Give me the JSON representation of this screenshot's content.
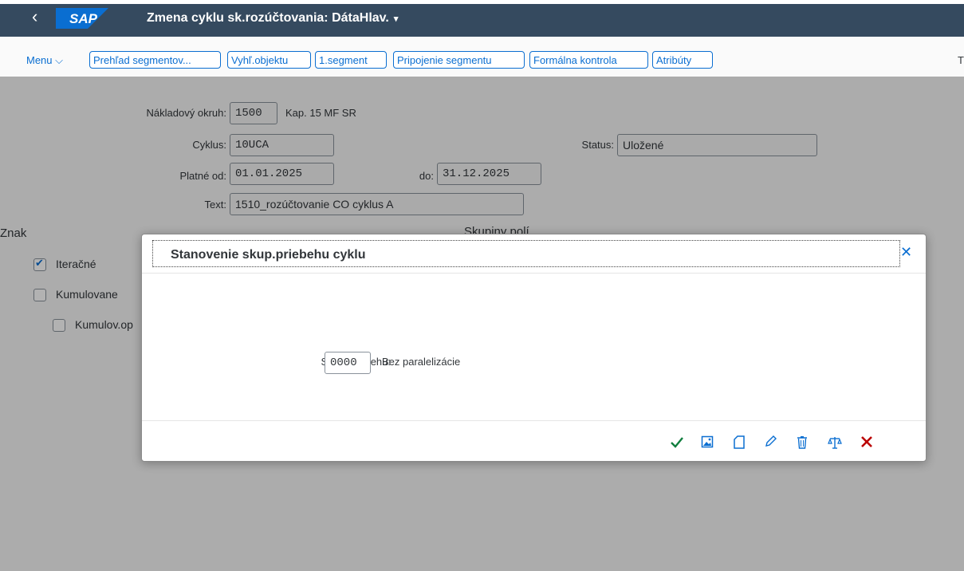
{
  "header": {
    "back_icon": "‹",
    "logo_text": "SAP",
    "title": "Zmena cyklu sk.rozúčtovania: DátaHlav.",
    "title_caret": "▾"
  },
  "toolbar": {
    "menu_label": "Menu ⌵",
    "buttons": [
      "Prehľad segmentov...",
      "Vyhľ.objektu",
      "1.segment",
      "Pripojenie segmentu",
      "Formálna kontrola",
      "Atribúty"
    ],
    "overflow_label": "T"
  },
  "form": {
    "cost_area_label": "Nákladový okruh:",
    "cost_area_value": "1500",
    "cost_area_desc": "Kap. 15 MF SR",
    "cycle_label": "Cyklus:",
    "cycle_value": "10UCA",
    "status_label": "Status:",
    "status_value": "Uložené",
    "valid_from_label": "Platné od:",
    "valid_from_value": "01.01.2025",
    "valid_to_label": "do:",
    "valid_to_value": "31.12.2025",
    "text_label": "Text:",
    "text_value": "1510_rozúčtovanie CO cyklus A"
  },
  "sections": {
    "attributes_title": "Znak",
    "field_groups_title": "Skupiny polí"
  },
  "checkboxes": [
    {
      "label": "Iteračné",
      "checked": true
    },
    {
      "label": "Kumulovane",
      "checked": false
    },
    {
      "label": "Kumulov.op",
      "checked": false
    }
  ],
  "dialog": {
    "title": "Stanovenie skup.priebehu cyklu",
    "close_icon": "✕",
    "run_group_label": "Skup.priebehu:",
    "run_group_value": "0000",
    "run_group_desc": "Bez paralelizácie",
    "footer_icons": [
      "checkmark-icon",
      "image-icon",
      "new-document-icon",
      "pencil-icon",
      "trash-icon",
      "balance-icon",
      "cancel-icon"
    ],
    "colors": {
      "confirm": "#107e3e",
      "cancel": "#bb0000",
      "accent": "#0a6ed1"
    }
  }
}
